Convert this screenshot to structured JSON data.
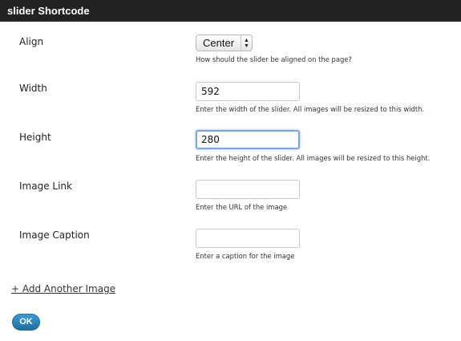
{
  "dialog": {
    "title": "slider Shortcode"
  },
  "fields": {
    "align": {
      "label": "Align",
      "selected": "Center",
      "help": "How should the slider be aligned on the page?"
    },
    "width": {
      "label": "Width",
      "value": "592",
      "help": "Enter the width of the slider. All images will be resized to this width."
    },
    "height": {
      "label": "Height",
      "value": "280",
      "help": "Enter the height of the slider. All images will be resized to this height."
    },
    "image_link": {
      "label": "Image Link",
      "value": "",
      "help": "Enter the URL of the image"
    },
    "image_caption": {
      "label": "Image Caption",
      "value": "",
      "help": "Enter a caption for the image"
    }
  },
  "actions": {
    "add_image_label": "+ Add Another Image",
    "ok_label": "OK"
  },
  "icons": {
    "select_arrows": "up-down-chevron-icon"
  },
  "colors": {
    "titlebar": "#222222",
    "ok_button": "#2a84bc",
    "focus_ring": "#7aa7d6"
  }
}
